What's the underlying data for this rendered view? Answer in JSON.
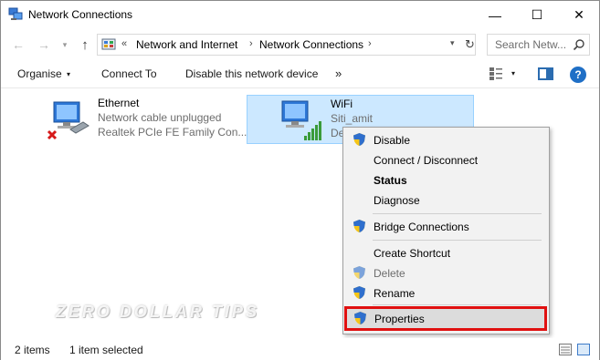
{
  "window": {
    "title": "Network Connections"
  },
  "titlebar": {
    "minimize_glyph": "—",
    "maximize_glyph": "☐",
    "close_glyph": "✕"
  },
  "address_bar": {
    "overflow_glyph": "«",
    "segments": [
      "Network and Internet",
      "Network Connections"
    ],
    "separator_glyph": "›",
    "dropdown_glyph": "▾",
    "refresh_glyph": "↻"
  },
  "search": {
    "placeholder": "Search Netw..."
  },
  "nav": {
    "back_glyph": "←",
    "forward_glyph": "→",
    "recent_glyph": "▾",
    "up_glyph": "↑"
  },
  "commandbar": {
    "organise": "Organise",
    "organise_arrow": "▾",
    "connect_to": "Connect To",
    "disable_device": "Disable this network device",
    "more": "»",
    "view_dropdown_glyph": "▾",
    "help_glyph": "?"
  },
  "adapters": [
    {
      "name": "Ethernet",
      "status": "Network cable unplugged",
      "device": "Realtek PCIe FE Family Con...",
      "selected": false,
      "icon": "ethernet-disconnected-icon"
    },
    {
      "name": "WiFi",
      "status": "Siti_amit",
      "device": "De",
      "selected": true,
      "icon": "wifi-adapter-icon"
    }
  ],
  "context_menu": {
    "items": [
      {
        "label": "Disable",
        "shield": true,
        "bold": false,
        "disabled": false
      },
      {
        "label": "Connect / Disconnect",
        "shield": false,
        "bold": false,
        "disabled": false
      },
      {
        "label": "Status",
        "shield": false,
        "bold": true,
        "disabled": false
      },
      {
        "label": "Diagnose",
        "shield": false,
        "bold": false,
        "disabled": false
      },
      {
        "label": "Bridge Connections",
        "shield": true,
        "bold": false,
        "disabled": false
      },
      {
        "label": "Create Shortcut",
        "shield": false,
        "bold": false,
        "disabled": false
      },
      {
        "label": "Delete",
        "shield": true,
        "bold": false,
        "disabled": true
      },
      {
        "label": "Rename",
        "shield": true,
        "bold": false,
        "disabled": false
      },
      {
        "label": "Properties",
        "shield": true,
        "bold": false,
        "disabled": false,
        "highlighted": true
      }
    ]
  },
  "watermark": "ZERO DOLLAR TIPS",
  "statusbar": {
    "item_count": "2 items",
    "selection": "1 item selected"
  },
  "colors": {
    "selection_bg": "#cce8ff",
    "highlight_border": "#e01010",
    "accent": "#1f6fc6"
  }
}
